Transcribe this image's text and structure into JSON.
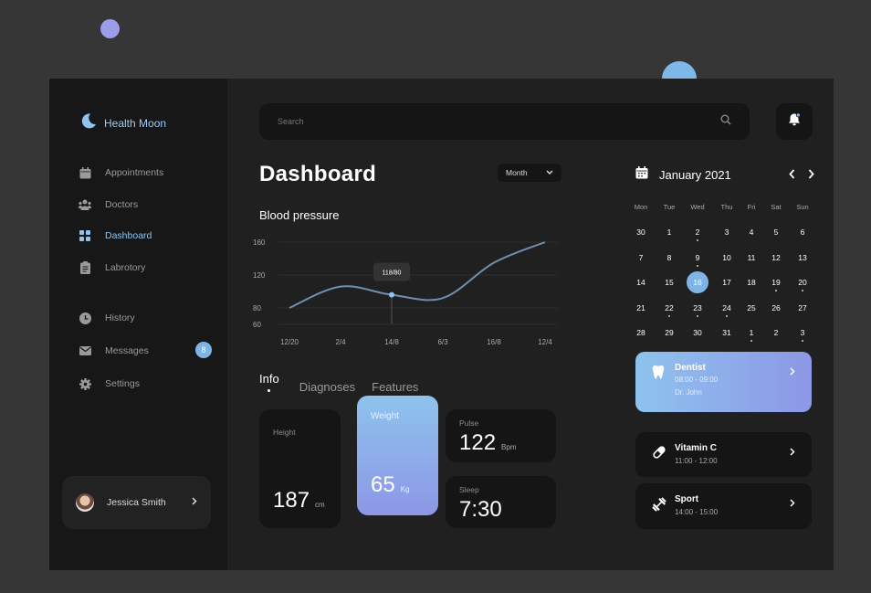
{
  "brand": {
    "name": "Health Moon"
  },
  "nav": [
    {
      "label": "Appointments",
      "icon": "calendar-icon"
    },
    {
      "label": "Doctors",
      "icon": "users-icon"
    },
    {
      "label": "Dashboard",
      "icon": "grid-icon",
      "active": true
    },
    {
      "label": "Labrotory",
      "icon": "clipboard-icon"
    },
    {
      "label": "History",
      "icon": "clock-icon"
    },
    {
      "label": "Messages",
      "icon": "mail-icon",
      "badge": "8"
    },
    {
      "label": "Settings",
      "icon": "gear-icon"
    }
  ],
  "user": {
    "name": "Jessica Smith"
  },
  "search": {
    "placeholder": "Search"
  },
  "header": {
    "title": "Dashboard",
    "range": "Month"
  },
  "chart_data": {
    "type": "line",
    "title": "Blood pressure",
    "x": [
      "12/20",
      "2/4",
      "14/8",
      "6/3",
      "16/8",
      "12/4"
    ],
    "series": [
      {
        "values": [
          80,
          106,
          96,
          92,
          135,
          160
        ]
      }
    ],
    "y_ticks": [
      160,
      120,
      80,
      60
    ],
    "ylim": [
      60,
      160
    ],
    "tooltip": {
      "label": "118/80",
      "x": "14/8"
    },
    "grid": true,
    "color": "#6f8fb0"
  },
  "tabs": [
    {
      "label": "Info",
      "active": true
    },
    {
      "label": "Diagnoses"
    },
    {
      "label": "Features"
    }
  ],
  "stats": {
    "height": {
      "label": "Height",
      "value": "187",
      "unit": "cm"
    },
    "weight": {
      "label": "Weight",
      "value": "65",
      "unit": "Kg"
    },
    "pulse": {
      "label": "Pulse",
      "value": "122",
      "unit": "Bpm"
    },
    "sleep": {
      "label": "Sleep",
      "value": "7:30"
    }
  },
  "calendar": {
    "title": "January 2021",
    "dow": [
      "Mon",
      "Tue",
      "Wed",
      "Thu",
      "Fri",
      "Sat",
      "Sun"
    ],
    "weeks": [
      [
        "30",
        "1",
        "2",
        "3",
        "4",
        "5",
        "6"
      ],
      [
        "7",
        "8",
        "9",
        "10",
        "11",
        "12",
        "13"
      ],
      [
        "14",
        "15",
        "16",
        "17",
        "18",
        "19",
        "20"
      ],
      [
        "21",
        "22",
        "23",
        "24",
        "25",
        "26",
        "27"
      ],
      [
        "28",
        "29",
        "30",
        "31",
        "1",
        "2",
        "3"
      ]
    ],
    "selected": "16",
    "dotted": [
      "2",
      "9",
      "19",
      "20",
      "22",
      "23",
      "24",
      "1",
      "3"
    ]
  },
  "events": [
    {
      "title": "Dentist",
      "time": "08:00 - 09:00",
      "doctor": "Dr. John",
      "icon": "tooth-icon",
      "highlight": true
    },
    {
      "title": "Vitamin C",
      "time": "11:00 - 12:00",
      "icon": "pill-icon"
    },
    {
      "title": "Sport",
      "time": "14:00 - 15:00",
      "icon": "dumbbell-icon"
    }
  ],
  "colors": {
    "accent": "#7fb5e6",
    "gradient_start": "#8ec3ee",
    "gradient_end": "#8d97e6",
    "bg": "#202020",
    "sidebar": "#171717"
  }
}
